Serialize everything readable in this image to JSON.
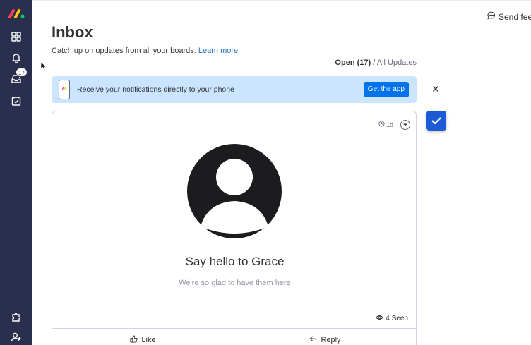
{
  "header": {
    "title": "Inbox",
    "subtitle": "Catch up on updates from all your boards.",
    "learn_more": "Learn more",
    "send_feedback": "Send feed"
  },
  "sidebar": {
    "inbox_badge": "17",
    "items": [
      "grid-icon",
      "bell-icon",
      "inbox-icon",
      "my-work-icon",
      "puzzle-icon",
      "invite-user-icon"
    ]
  },
  "filter": {
    "open_label": "Open (17)",
    "separator": "/",
    "all_label": "All Updates"
  },
  "banner": {
    "text": "Receive your notifications directly to your phone",
    "button": "Get the app"
  },
  "card": {
    "time": "1d",
    "heading": "Say hello to Grace",
    "subheading": "We're so glad to have them here",
    "seen": "4 Seen",
    "like_label": "Like",
    "reply_label": "Reply"
  },
  "colors": {
    "sidebar": "#292f4c",
    "accent": "#0073ea",
    "banner": "#cce5ff",
    "check": "#1b5bd6"
  }
}
